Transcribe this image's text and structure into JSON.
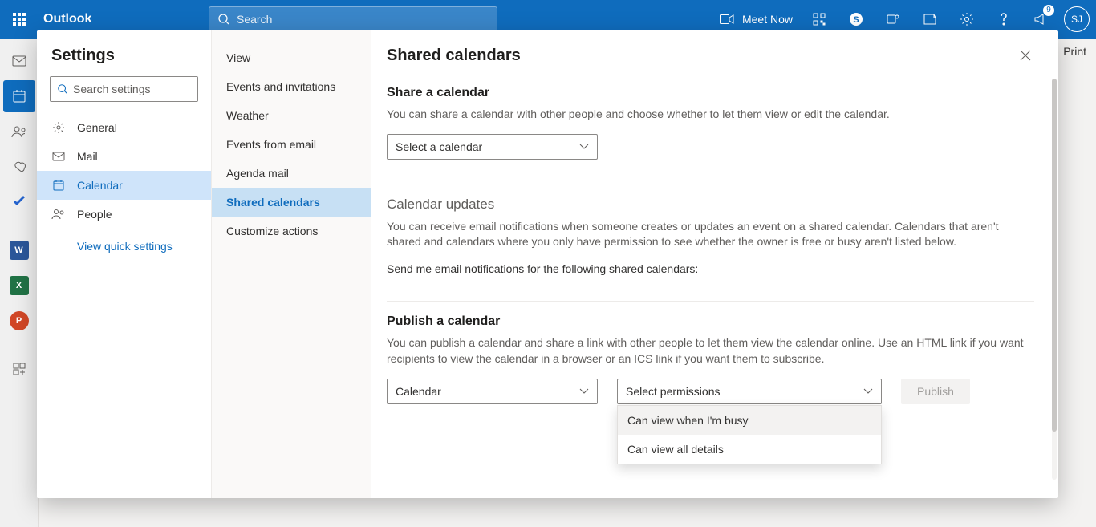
{
  "header": {
    "app_name": "Outlook",
    "search_placeholder": "Search",
    "meet_now": "Meet Now",
    "notif_count": "9",
    "avatar_initials": "SJ"
  },
  "rail": {
    "word": "W",
    "excel": "X",
    "ppt": "P"
  },
  "toolbar": {
    "print": "Print"
  },
  "settings": {
    "title": "Settings",
    "search_placeholder": "Search settings",
    "nav": {
      "general": "General",
      "mail": "Mail",
      "calendar": "Calendar",
      "people": "People",
      "quick": "View quick settings"
    },
    "sub": {
      "view": "View",
      "events": "Events and invitations",
      "weather": "Weather",
      "events_email": "Events from email",
      "agenda": "Agenda mail",
      "shared": "Shared calendars",
      "customize": "Customize actions"
    }
  },
  "panel": {
    "title": "Shared calendars",
    "share": {
      "heading": "Share a calendar",
      "desc": "You can share a calendar with other people and choose whether to let them view or edit the calendar.",
      "select_placeholder": "Select a calendar"
    },
    "updates": {
      "heading": "Calendar updates",
      "desc": "You can receive email notifications when someone creates or updates an event on a shared calendar. Calendars that aren't shared and calendars where you only have permission to see whether the owner is free or busy aren't listed below.",
      "instruction": "Send me email notifications for the following shared calendars:"
    },
    "publish": {
      "heading": "Publish a calendar",
      "desc": "You can publish a calendar and share a link with other people to let them view the calendar online. Use an HTML link if you want recipients to view the calendar in a browser or an ICS link if you want them to subscribe.",
      "calendar_value": "Calendar",
      "permissions_placeholder": "Select permissions",
      "publish_btn": "Publish",
      "options": {
        "busy": "Can view when I'm busy",
        "all": "Can view all details"
      }
    }
  }
}
